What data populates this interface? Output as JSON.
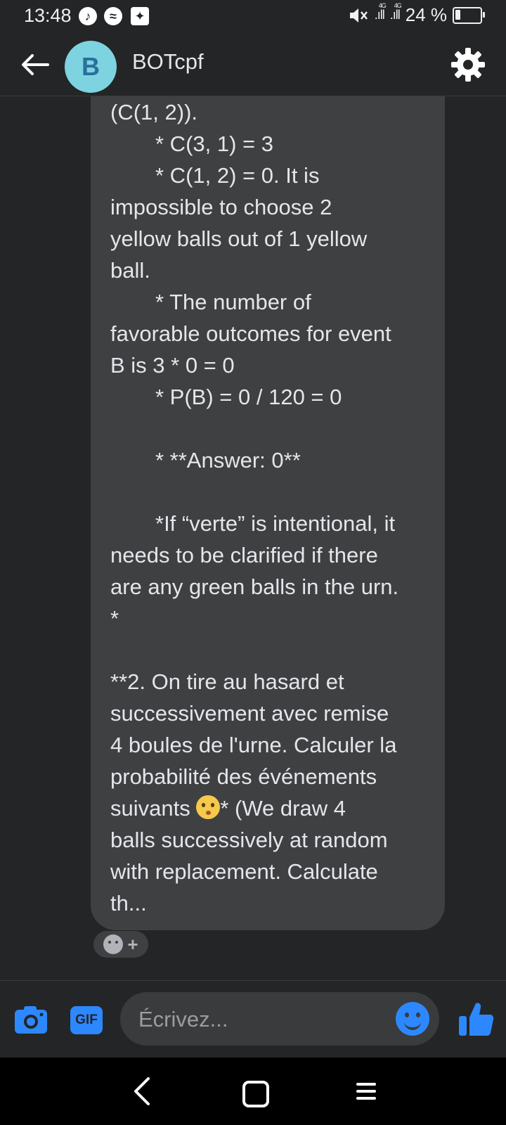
{
  "status_bar": {
    "time": "13:48",
    "app_icons": [
      "tiktok-icon",
      "messenger-icon",
      "shield-icon"
    ],
    "network_label_1": "4G",
    "network_label_2": "4G",
    "battery_text": "24 %",
    "battery_level": 0.24
  },
  "header": {
    "avatar_letter": "B",
    "title": "BOTcpf",
    "back_icon": "arrow-left-icon",
    "settings_icon": "gear-icon"
  },
  "message": {
    "lines": [
      "(C(1, 2)).",
      "*   C(3, 1) = 3",
      "*   C(1, 2) = 0. It is",
      "impossible to choose 2",
      "yellow balls out of 1 yellow",
      "ball.",
      "*   The number of",
      "favorable outcomes for event",
      "B is 3 * 0 = 0",
      "*   P(B) = 0 / 120 = 0",
      "*   **Answer: 0**",
      "*If “verte” is intentional, it",
      "needs to be clarified if there",
      "are any green balls in the urn.",
      "*",
      "**2. On tire au hasard et",
      "successivement avec remise",
      "4 boules de l'urne. Calculer la",
      "probabilité des événements",
      "suivants ",
      "* (We draw 4",
      "balls successively at random",
      "with replacement. Calculate",
      "th..."
    ]
  },
  "composer": {
    "placeholder": "Écrivez...",
    "gif_label": "GIF"
  }
}
